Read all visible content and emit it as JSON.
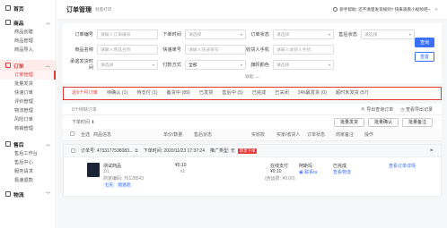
{
  "sidebar": {
    "home": "首页",
    "goods": {
      "label": "商品",
      "items": [
        "商品创建",
        "商品管理",
        "商品导入"
      ]
    },
    "order": {
      "label": "订单",
      "items": [
        "订单管理",
        "批量发货",
        "快递订单",
        "评价管理",
        "物流管理",
        "风险订单",
        "核销管理"
      ],
      "active": "订单管理"
    },
    "aftersale": {
      "label": "售后",
      "items": [
        "售后工作台",
        "售后中心",
        "服务请求",
        "极速退款"
      ]
    },
    "logistics": {
      "label": "物流"
    }
  },
  "header": {
    "title": "订单管理",
    "subtitle": "批量打印",
    "notice": "新手帮助: 还不清楚发货规则?  快来观看小视频吧~"
  },
  "filters": {
    "row1": [
      {
        "label": "订单编号",
        "placeholder": "请输入订单编号"
      },
      {
        "label": "下单时间",
        "placeholder": "请选择"
      },
      {
        "label": "订单状态",
        "placeholder": "请选择"
      },
      {
        "label": "售后状态",
        "placeholder": "请选择"
      }
    ],
    "row2": [
      {
        "label": "商品名称",
        "placeholder": "请输入商品名称"
      },
      {
        "label": "快递单号",
        "placeholder": "请输入快递单号"
      },
      {
        "label": "收货人手机",
        "placeholder": "请输入收货人手机"
      }
    ],
    "row3": [
      {
        "label": "承诺发货时间",
        "placeholder": "请选择"
      },
      {
        "label": "付款方式",
        "value": "全部"
      },
      {
        "label": "旗帜颜色",
        "placeholder": "请选择"
      }
    ],
    "query": "查询",
    "reset": "重置",
    "collapse": "收起"
  },
  "tabs": [
    "近6个月订单",
    "待确认 (1)",
    "待支付 (1)",
    "备货中 (89)",
    "已发货",
    "售后中 (5)",
    "已完成",
    "已关闭",
    "24h最发货 (0)",
    "超时未发货 (57)"
  ],
  "toolbar": {
    "left": "0个待缺订单",
    "export": "导出查询订单",
    "view_export": "查看导出记录"
  },
  "listbar": {
    "sort": "下单时间",
    "batch_ship": "批量发货",
    "batch_confirm": "批量确认",
    "batch_note": "批量备注"
  },
  "thead": [
    "全选",
    "商品信息",
    "单价/数量",
    "售后状态",
    "实收款",
    "买家/收货人",
    "订单状态",
    "商家备注",
    "操作"
  ],
  "order": {
    "order_no": "订单号: 4733177538083...",
    "order_time": "下单时间: 2020/11/23 17:37:24",
    "promo": "推广类型: 无",
    "tag": "新享下单",
    "product_name": "测试商品",
    "spec": "Z/L",
    "code": "商家编码: 76128543",
    "tag_seven": "七天",
    "tag_refund": "极速退",
    "price": "¥0.10",
    "qty": "x1",
    "pay_method": "在线支付",
    "paid": "¥0.10",
    "freight": "(含运费: ¥0.00)",
    "buyer": "阿斯玛",
    "contact": "联系ta",
    "status": "已完成",
    "view_logistics": "查看物流",
    "detail": "查看订单详情"
  }
}
